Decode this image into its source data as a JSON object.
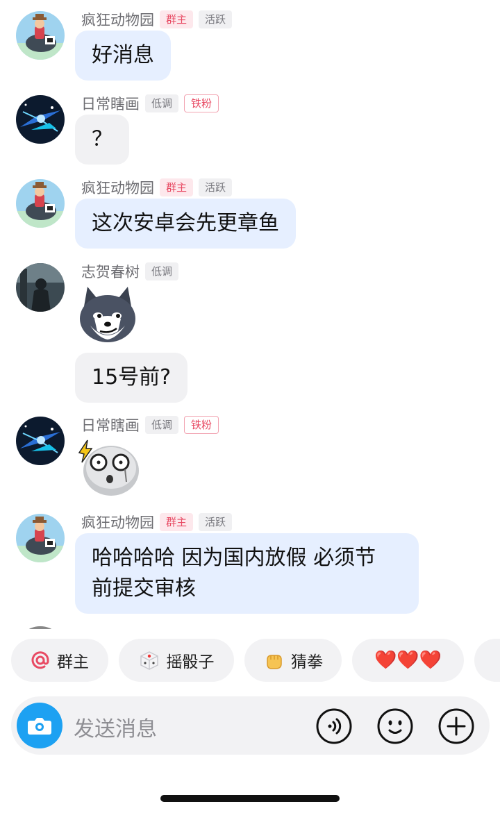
{
  "messages": [
    {
      "user": "疯狂动物园",
      "badges": [
        "群主",
        "活跃"
      ],
      "text": "好消息"
    },
    {
      "user": "日常瞎画",
      "badges": [
        "低调",
        "铁粉"
      ],
      "text": "？"
    },
    {
      "user": "疯狂动物园",
      "badges": [
        "群主",
        "活跃"
      ],
      "text": "这次安卓会先更章鱼"
    },
    {
      "user": "志贺春树",
      "badges": [
        "低调"
      ],
      "sticker": "husky-sticker",
      "text": "15号前?"
    },
    {
      "user": "日常瞎画",
      "badges": [
        "低调",
        "铁粉"
      ],
      "sticker": "shocked-emoji-sticker"
    },
    {
      "user": "疯狂动物园",
      "badges": [
        "群主",
        "活跃"
      ],
      "text_line1": "哈哈哈哈 因为国内放假 必须节",
      "text_line2": "前提交审核"
    }
  ],
  "quick_replies": [
    {
      "icon": "at-icon",
      "label": "群主"
    },
    {
      "icon": "dice-icon",
      "label": "摇骰子"
    },
    {
      "icon": "fist-icon",
      "label": "猜拳"
    },
    {
      "icon": "hearts-icon",
      "label": "❤️❤️❤️"
    }
  ],
  "input": {
    "placeholder": "发送消息"
  },
  "colors": {
    "accent": "#1da1f2",
    "bubble_blue": "#e6efff",
    "bubble_grey": "#f1f1f3",
    "owner_badge": "#e84a63"
  }
}
